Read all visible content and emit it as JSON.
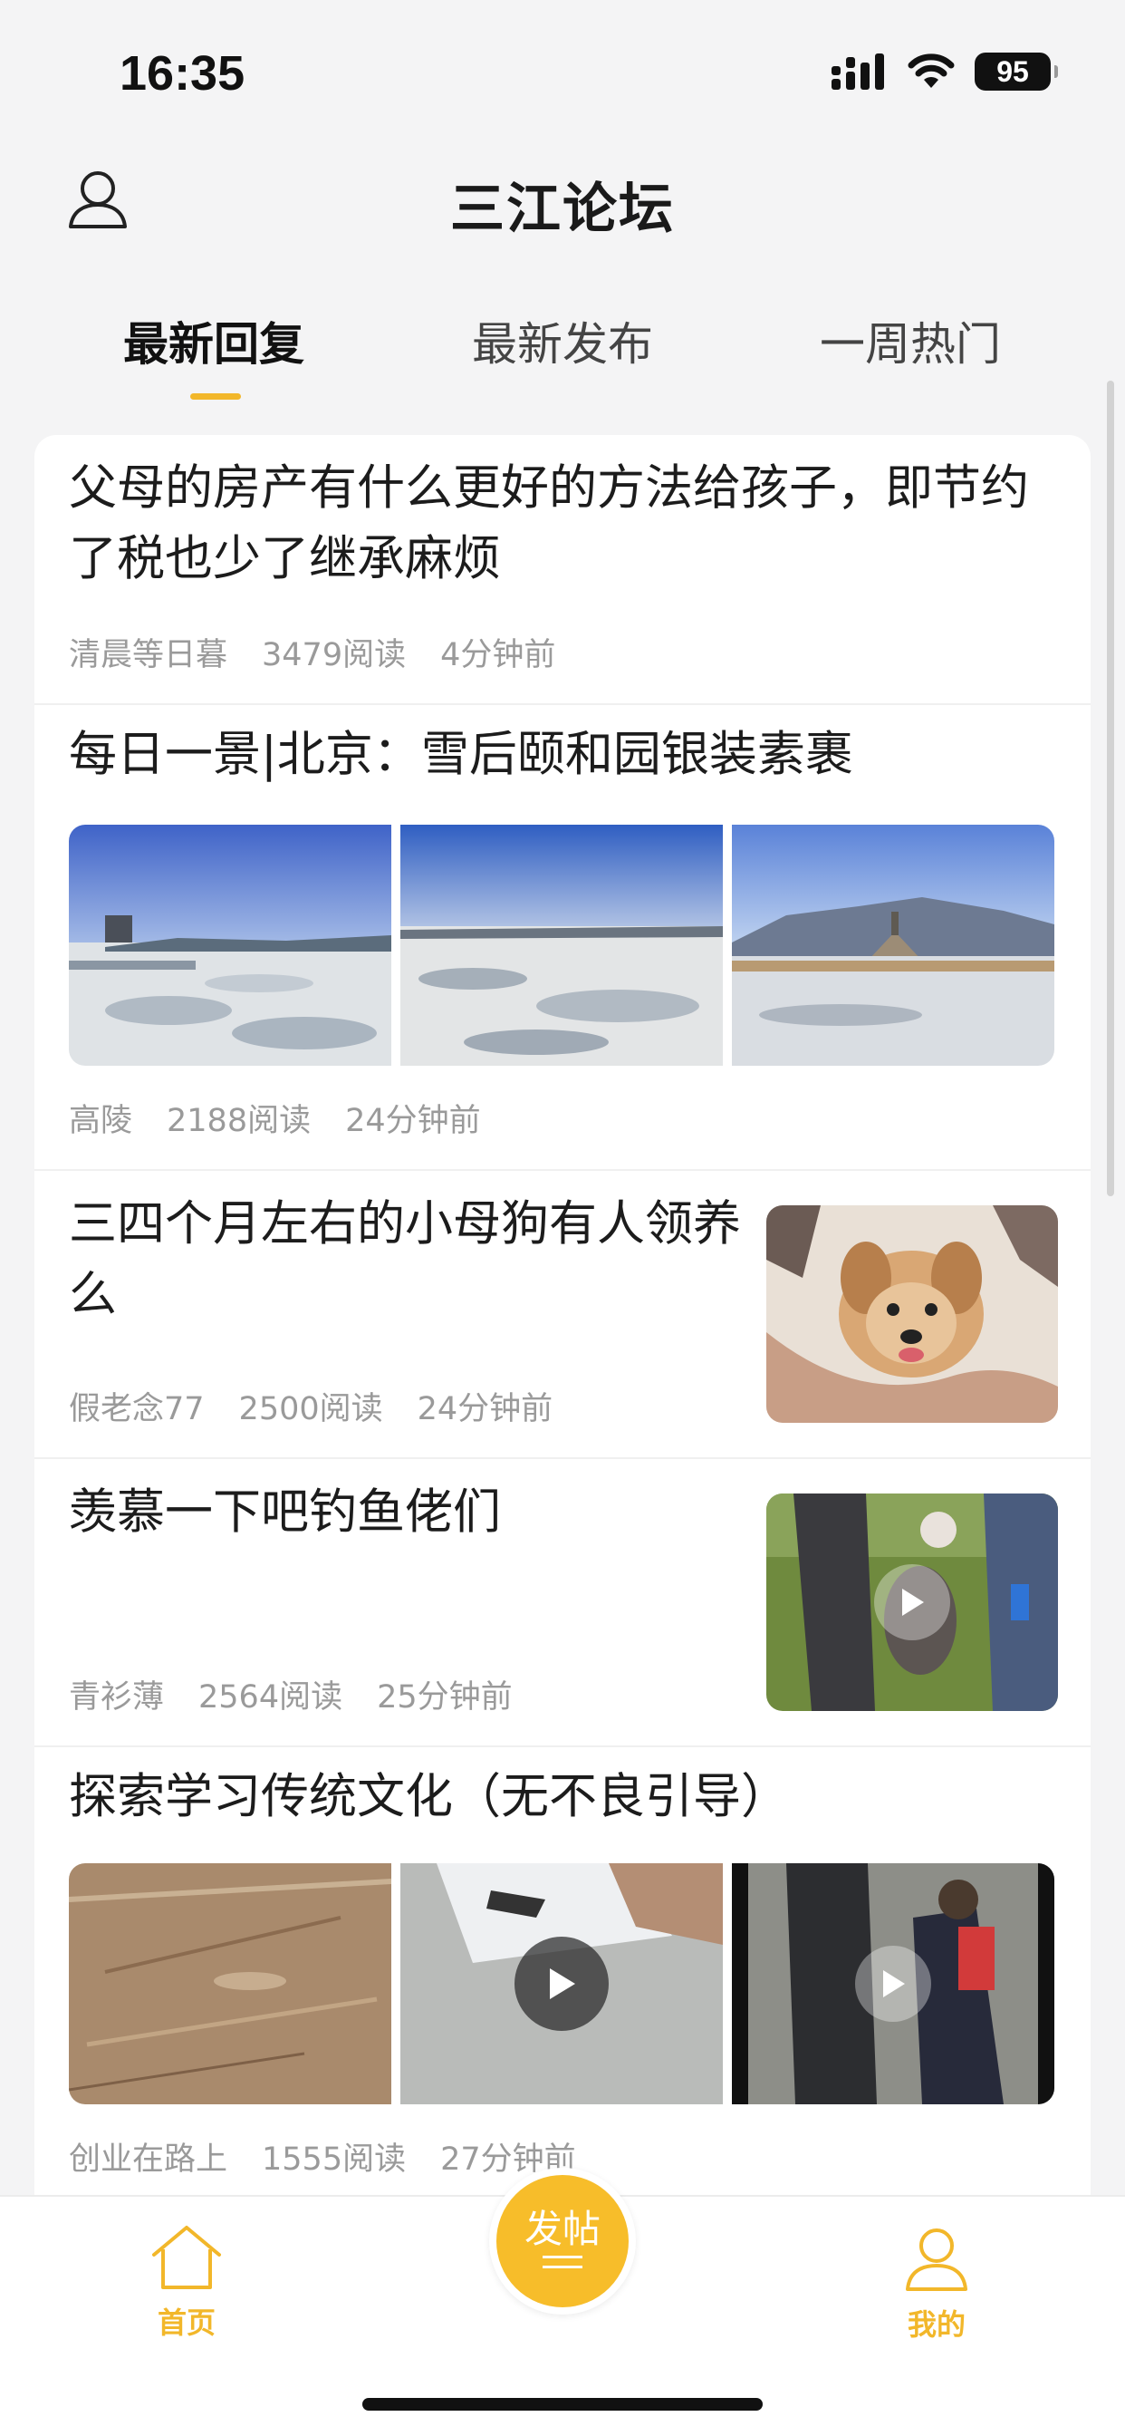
{
  "status": {
    "time": "16:35",
    "battery": "95"
  },
  "header": {
    "title": "三江论坛"
  },
  "tabs": [
    {
      "label": "最新回复",
      "active": true
    },
    {
      "label": "最新发布",
      "active": false
    },
    {
      "label": "一周热门",
      "active": false
    }
  ],
  "posts": [
    {
      "title": "父母的房产有什么更好的方法给孩子，即节约了税也少了继承麻烦",
      "author": "清晨等日暮",
      "reads": "3479阅读",
      "time": "4分钟前"
    },
    {
      "title": "每日一景|北京：雪后颐和园银装素裹",
      "author": "高陵",
      "reads": "2188阅读",
      "time": "24分钟前"
    },
    {
      "title": "三四个月左右的小母狗有人领养么",
      "author": "假老念77",
      "reads": "2500阅读",
      "time": "24分钟前"
    },
    {
      "title": "羡慕一下吧钓鱼佬们",
      "author": "青衫薄",
      "reads": "2564阅读",
      "time": "25分钟前"
    },
    {
      "title": "探索学习传统文化（无不良引导）",
      "author": "创业在路上",
      "reads": "1555阅读",
      "time": "27分钟前"
    }
  ],
  "tabbar": {
    "home": "首页",
    "post": "发帖",
    "mine": "我的"
  },
  "colors": {
    "accent": "#f2b72a",
    "background": "#f4f4f5"
  },
  "icons": [
    "user-outline-icon",
    "home-icon",
    "play-icon",
    "signal-icon",
    "wifi-icon",
    "battery-icon"
  ]
}
